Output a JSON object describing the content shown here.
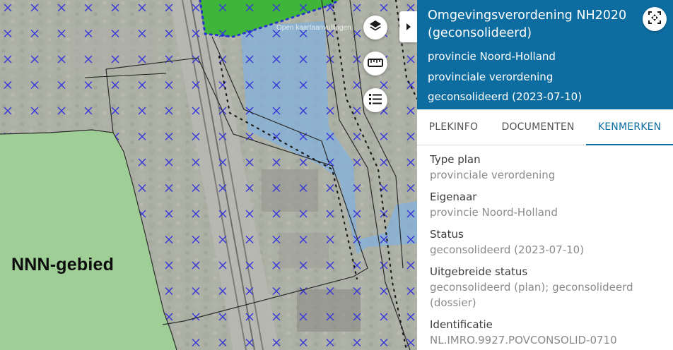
{
  "map": {
    "area_label": "NNN-gebied",
    "watermark": "Open kaartaanvullingen",
    "controls": {
      "layers_icon": "layers-icon",
      "measure_icon": "ruler-icon",
      "legend_icon": "list-icon"
    },
    "colors": {
      "nature": "#9fcf96",
      "hatch": "#3838d8",
      "green_zone": "#3fb53a",
      "water": "#7fb0df"
    }
  },
  "panel": {
    "title": "Omgevingsverordening NH2020 (geconsolideerd)",
    "subtitles": [
      "provincie Noord-Holland",
      "provinciale verordening",
      "geconsolideerd (2023-07-10)"
    ],
    "fit_icon": "zoom-to-extent-icon",
    "tabs": [
      {
        "label": "PLEKINFO",
        "active": false
      },
      {
        "label": "DOCUMENTEN",
        "active": false
      },
      {
        "label": "KENMERKEN",
        "active": true
      }
    ],
    "properties": [
      {
        "label": "Type plan",
        "value": "provinciale verordening"
      },
      {
        "label": "Eigenaar",
        "value": "provincie Noord-Holland"
      },
      {
        "label": "Status",
        "value": "geconsolideerd (2023-07-10)"
      },
      {
        "label": "Uitgebreide status",
        "value": "geconsolideerd (plan); geconsolideerd (dossier)"
      },
      {
        "label": "Identificatie",
        "value": "NL.IMRO.9927.POVCONSOLID-0710"
      }
    ],
    "accent_color": "#0d6da0"
  }
}
